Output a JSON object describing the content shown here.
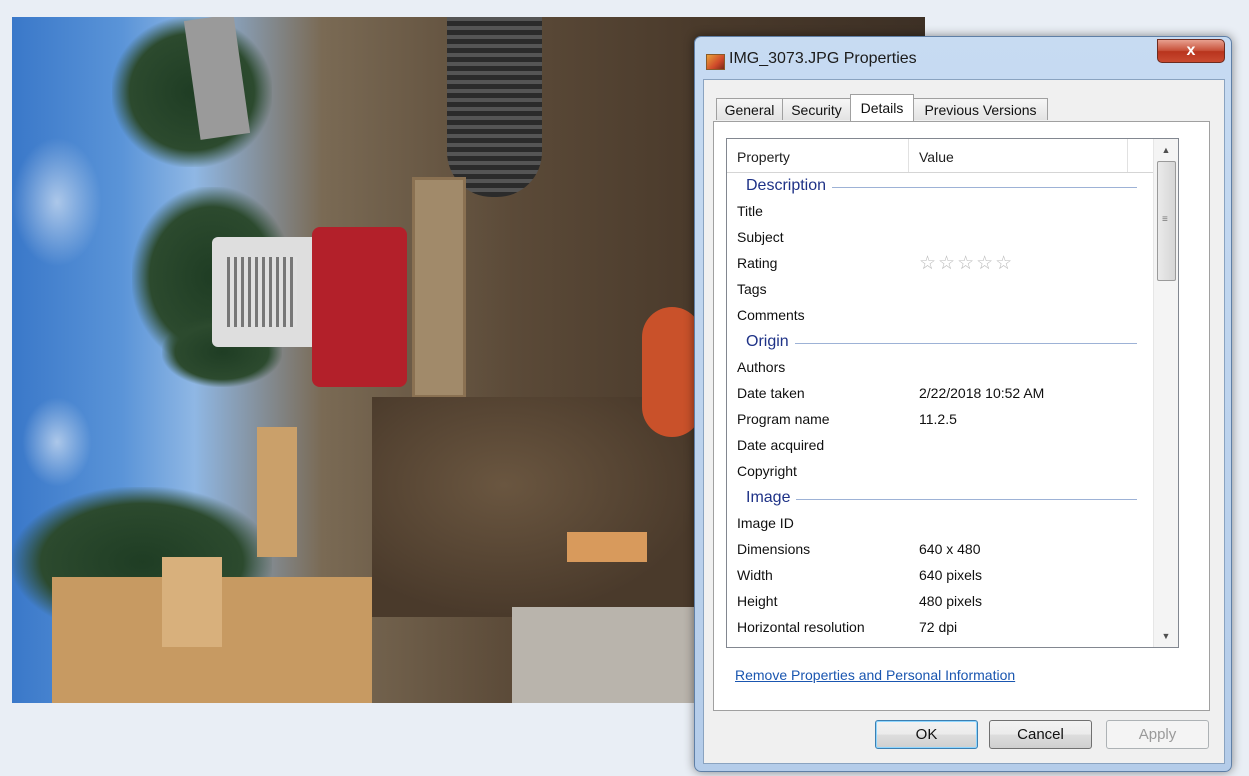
{
  "window": {
    "title": "IMG_3073.JPG Properties",
    "close_glyph": "x"
  },
  "tabs": [
    {
      "label": "General"
    },
    {
      "label": "Security"
    },
    {
      "label": "Details"
    },
    {
      "label": "Previous Versions"
    }
  ],
  "active_tab": "Details",
  "list": {
    "columns": {
      "property": "Property",
      "value": "Value"
    },
    "rows": [
      {
        "kind": "group",
        "label": "Description"
      },
      {
        "kind": "item",
        "property": "Title",
        "value": ""
      },
      {
        "kind": "item",
        "property": "Subject",
        "value": ""
      },
      {
        "kind": "rating",
        "property": "Rating",
        "value": "☆☆☆☆☆",
        "stars_filled": 0,
        "stars_total": 5
      },
      {
        "kind": "item",
        "property": "Tags",
        "value": ""
      },
      {
        "kind": "item",
        "property": "Comments",
        "value": ""
      },
      {
        "kind": "group",
        "label": "Origin"
      },
      {
        "kind": "item",
        "property": "Authors",
        "value": ""
      },
      {
        "kind": "item",
        "property": "Date taken",
        "value": "2/22/2018 10:52 AM"
      },
      {
        "kind": "item",
        "property": "Program name",
        "value": "11.2.5"
      },
      {
        "kind": "item",
        "property": "Date acquired",
        "value": ""
      },
      {
        "kind": "item",
        "property": "Copyright",
        "value": ""
      },
      {
        "kind": "group",
        "label": "Image"
      },
      {
        "kind": "item",
        "property": "Image ID",
        "value": ""
      },
      {
        "kind": "item",
        "property": "Dimensions",
        "value": "640 x 480"
      },
      {
        "kind": "item",
        "property": "Width",
        "value": "640 pixels"
      },
      {
        "kind": "item",
        "property": "Height",
        "value": "480 pixels"
      },
      {
        "kind": "item",
        "property": "Horizontal resolution",
        "value": "72 dpi"
      }
    ]
  },
  "scrollbar": {
    "up_glyph": "▲",
    "down_glyph": "▼",
    "grip": "≡"
  },
  "remove_link": "Remove Properties and Personal Information",
  "buttons": {
    "ok": "OK",
    "cancel": "Cancel",
    "apply": "Apply"
  },
  "icons": {
    "title_icon": "jpg-file-icon",
    "close": "close-icon",
    "rating": "star-icon"
  },
  "colors": {
    "link": "#1a56b0",
    "group_header": "#1e3287",
    "close_button": "#c8513a"
  }
}
